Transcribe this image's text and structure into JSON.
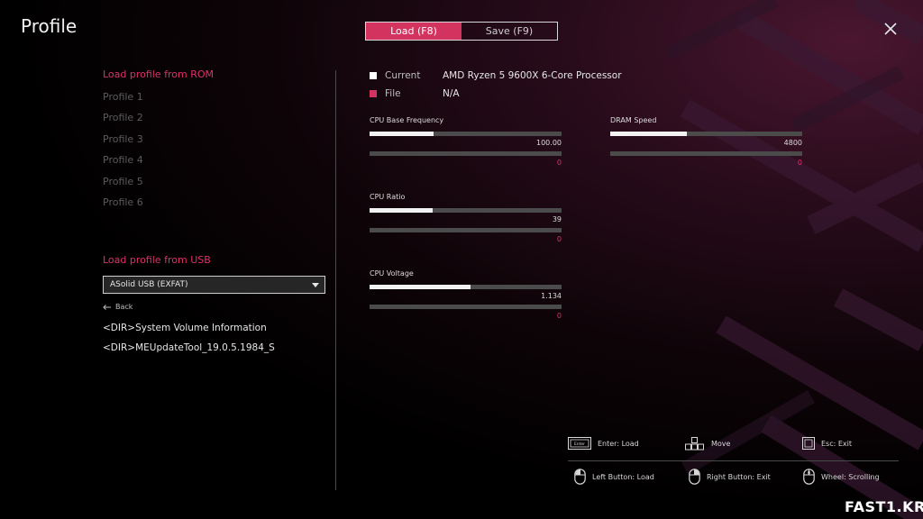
{
  "window": {
    "title": "Profile"
  },
  "tabs": [
    {
      "label": "Load (F8)",
      "active": true
    },
    {
      "label": "Save (F9)",
      "active": false
    }
  ],
  "rom_section": {
    "heading": "Load profile from ROM",
    "profiles": [
      "Profile 1",
      "Profile 2",
      "Profile 3",
      "Profile 4",
      "Profile 5",
      "Profile 6"
    ]
  },
  "usb_section": {
    "heading": "Load profile from USB",
    "selected_device": "ASolid USB  (EXFAT)",
    "back_label": "Back",
    "entries": [
      "<DIR>System Volume Information",
      "<DIR>MEUpdateTool_19.0.5.1984_S"
    ]
  },
  "info": {
    "current": {
      "key": "Current",
      "value": "AMD Ryzen 5 9600X 6-Core Processor",
      "color": "#ffffff"
    },
    "file": {
      "key": "File",
      "value": "N/A",
      "color": "#d2345f"
    }
  },
  "params": {
    "cpu_base_freq": {
      "label": "CPU Base Frequency",
      "current_value": "100.00",
      "current_fraction": 0.335,
      "file_value": "0",
      "file_fraction": 0
    },
    "dram_speed": {
      "label": "DRAM Speed",
      "current_value": "4800",
      "current_fraction": 0.4,
      "file_value": "0",
      "file_fraction": 0
    },
    "cpu_ratio": {
      "label": "CPU Ratio",
      "current_value": "39",
      "current_fraction": 0.33,
      "file_value": "0",
      "file_fraction": 0
    },
    "cpu_voltage": {
      "label": "CPU Voltage",
      "current_value": "1.134",
      "current_fraction": 0.525,
      "file_value": "0",
      "file_fraction": 0
    }
  },
  "help": {
    "enter": {
      "text": "Enter: Load",
      "key_label": "Enter"
    },
    "move": {
      "text": "Move"
    },
    "esc": {
      "text": "Esc: Exit"
    },
    "left_button": {
      "text": "Left Button: Load"
    },
    "right_button": {
      "text": "Right Button: Exit"
    },
    "wheel": {
      "text": "Wheel: Scrolling"
    }
  },
  "watermark": "FAST1.KR",
  "colors": {
    "accent": "#d2345f",
    "accent_text": "#e0306a"
  }
}
